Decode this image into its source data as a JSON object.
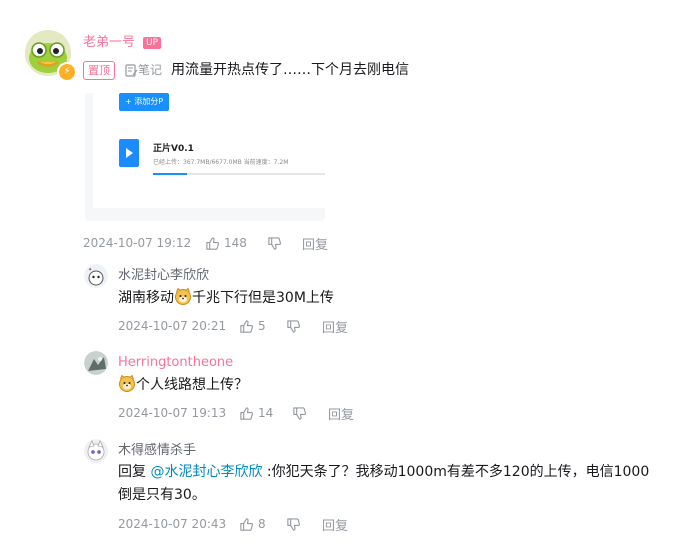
{
  "main_comment": {
    "username": "老弟一号",
    "up_tag": "UP",
    "pin_tag": "置顶",
    "note_tag": "笔记",
    "text": "用流量开热点传了……下个月去刚电信",
    "date": "2024-10-07 19:12",
    "likes": "148",
    "reply_label": "回复",
    "screenshot": {
      "button": "+ 添加分P",
      "file_name": "正片V0.1",
      "file_info": "已经上传：367.7MB/6677.0MB   当前速度：7.2M",
      "progress": 0.2
    }
  },
  "replies": [
    {
      "username": "水泥封心李欣欣",
      "text_before": "湖南移动",
      "text_after": "千兆下行但是30M上传",
      "date": "2024-10-07 20:21",
      "likes": "5",
      "reply_label": "回复"
    },
    {
      "username": "Herringtontheone",
      "text_after": "个人线路想上传？",
      "date": "2024-10-07 19:13",
      "likes": "14",
      "reply_label": "回复"
    },
    {
      "username": "木得感情杀手",
      "reply_prefix": "回复 ",
      "mention": "@水泥封心李欣欣",
      "text_line1": " :你犯天条了？我移动1000m有差不多120的上传，电信1000",
      "text_line2": "倒是只有30。",
      "date": "2024-10-07 20:43",
      "likes": "8",
      "reply_label": "回复"
    }
  ],
  "colors": {
    "pink": "#fb7299",
    "link": "#008ac5",
    "meta": "#9499a0"
  }
}
